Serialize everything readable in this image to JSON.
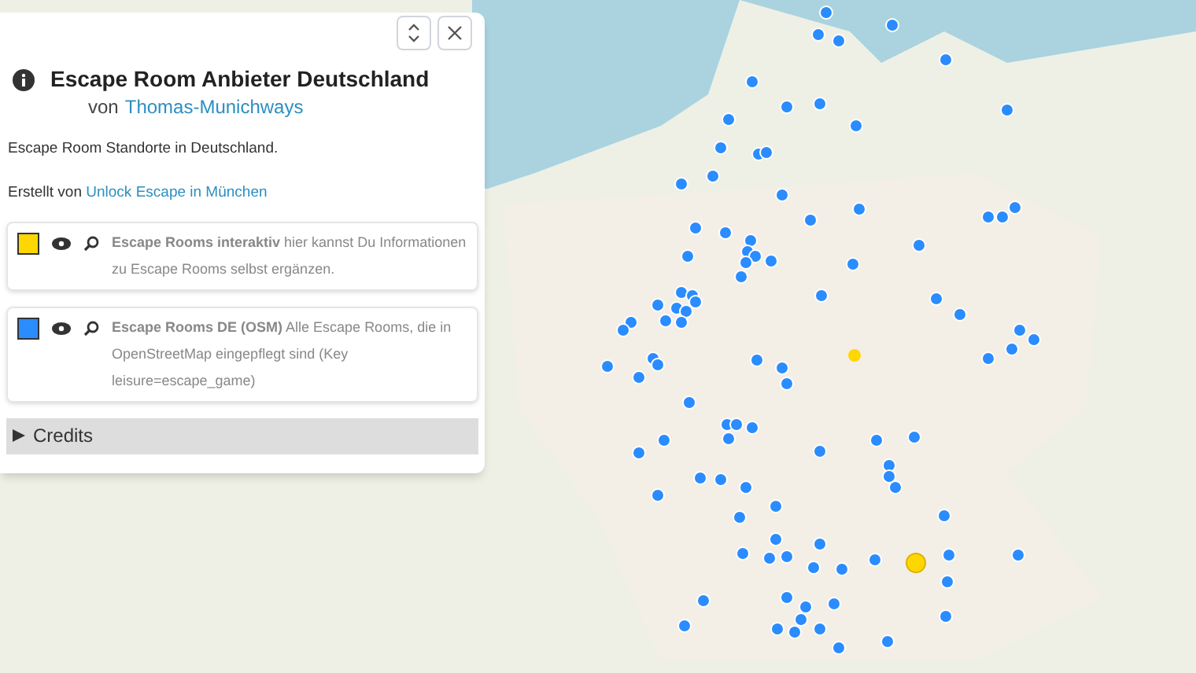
{
  "panel": {
    "title": "Escape Room Anbieter Deutschland",
    "author_prefix": "von",
    "author": "Thomas-Munichways",
    "description": "Escape Room Standorte in Deutschland.",
    "created_prefix": "Erstellt von",
    "created_link": "Unlock Escape in München",
    "layers": [
      {
        "color": "#ffd700",
        "text": "**Escape Rooms interaktiv** hier kannst Du Informationen zu Escape Rooms selbst ergänzen."
      },
      {
        "color": "#2a8cff",
        "text": "**Escape Rooms DE (OSM)** Alle Escape Rooms, die in OpenStreetMap eingepflegt sind (Key leisure=escape_game)"
      }
    ],
    "credits": {
      "label": "Credits",
      "expanded": false
    }
  }
}
